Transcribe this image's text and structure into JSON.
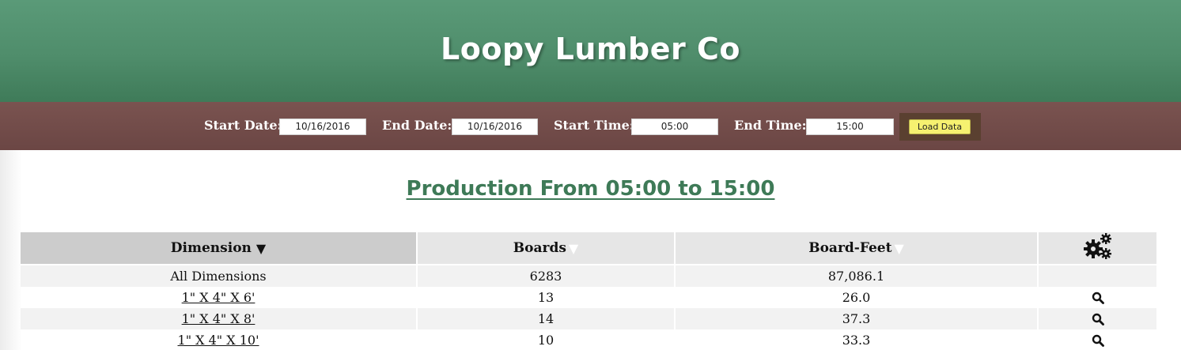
{
  "header": {
    "title": "Loopy Lumber Co"
  },
  "filters": {
    "start_date_label": "Start Date:",
    "start_date_value": "10/16/2016",
    "end_date_label": "End Date:",
    "end_date_value": "10/16/2016",
    "start_time_label": "Start Time:",
    "start_time_value": "05:00",
    "end_time_label": "End Time:",
    "end_time_value": "15:00",
    "load_button": "Load Data"
  },
  "report": {
    "title": "Production From 05:00 to 15:00"
  },
  "table": {
    "columns": {
      "dimension": "Dimension",
      "boards": "Boards",
      "board_feet": "Board-Feet"
    },
    "settings_icon": "gears-icon",
    "summary": {
      "dimension": "All Dimensions",
      "boards": "6283",
      "board_feet": "87,086.1"
    },
    "rows": [
      {
        "dimension": "1\" X 4\" X 6'",
        "boards": "13",
        "board_feet": "26.0",
        "action_icon": "magnifier-icon"
      },
      {
        "dimension": "1\" X 4\" X 8'",
        "boards": "14",
        "board_feet": "37.3",
        "action_icon": "magnifier-icon"
      },
      {
        "dimension": "1\" X 4\" X 10'",
        "boards": "10",
        "board_feet": "33.3",
        "action_icon": "magnifier-icon"
      }
    ]
  },
  "colors": {
    "header_green": "#4f8d6b",
    "filter_bar_brown": "#6b4644",
    "title_green": "#3e7a57",
    "button_yellow": "#f6f170"
  }
}
